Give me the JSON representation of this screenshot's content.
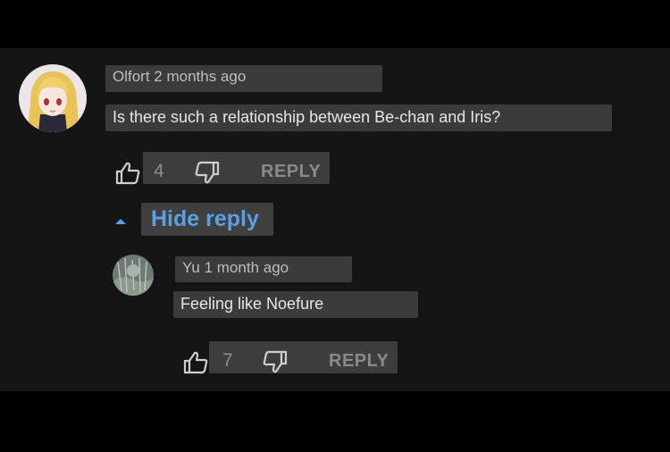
{
  "comment": {
    "author": "Olfort",
    "time": "2 months ago",
    "text": "Is there such a relationship between Be-chan and Iris?",
    "likes": "4",
    "reply_label": "REPLY"
  },
  "toggle": {
    "label": "Hide reply"
  },
  "reply": {
    "author": "Yu",
    "time": "1 month ago",
    "text": "Feeling like Noefure",
    "likes": "7",
    "reply_label": "REPLY"
  },
  "icons": {
    "like": "thumbs-up-icon",
    "dislike": "thumbs-down-icon",
    "toggle": "caret-up-icon"
  },
  "colors": {
    "background": "#151515",
    "link": "#5b9fe6",
    "text": "#e6e6e6"
  }
}
